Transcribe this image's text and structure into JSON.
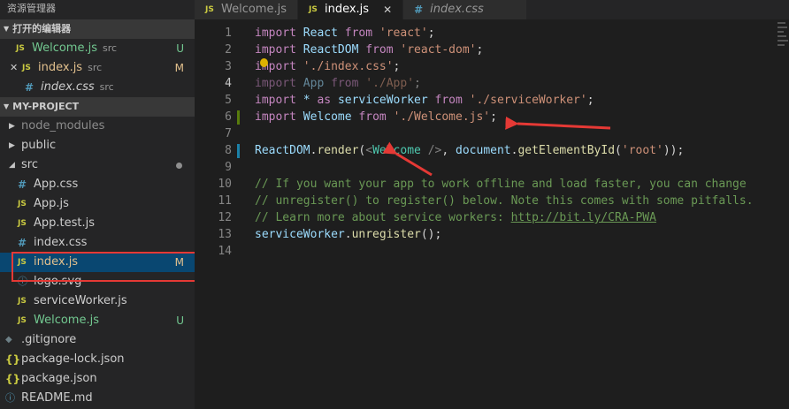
{
  "sidebar": {
    "title": "资源管理器",
    "open_editors": {
      "header": "打开的编辑器",
      "items": [
        {
          "name": "Welcome.js",
          "hint": "src",
          "status": "U"
        },
        {
          "name": "index.js",
          "hint": "src",
          "status": "M",
          "close": "✕"
        },
        {
          "name": "index.css",
          "hint": "src",
          "status": ""
        }
      ]
    },
    "project": {
      "header": "MY-PROJECT",
      "items": [
        {
          "name": "node_modules"
        },
        {
          "name": "public"
        },
        {
          "name": "src"
        },
        {
          "name": "App.css"
        },
        {
          "name": "App.js"
        },
        {
          "name": "App.test.js"
        },
        {
          "name": "index.css"
        },
        {
          "name": "index.js",
          "status": "M"
        },
        {
          "name": "logo.svg"
        },
        {
          "name": "serviceWorker.js"
        },
        {
          "name": "Welcome.js",
          "status": "U"
        },
        {
          "name": ".gitignore"
        },
        {
          "name": "package-lock.json"
        },
        {
          "name": "package.json"
        },
        {
          "name": "README.md"
        }
      ]
    }
  },
  "tabs": [
    {
      "label": "Welcome.js",
      "icon": "JS"
    },
    {
      "label": "index.js",
      "icon": "JS",
      "close": "✕"
    },
    {
      "label": "index.css",
      "icon": "#"
    }
  ],
  "icons": {
    "js": "JS",
    "css": "#",
    "json": "{}",
    "git": "◆",
    "info": "ⓘ"
  },
  "editor": {
    "lines": [
      {
        "n": "1"
      },
      {
        "n": "2"
      },
      {
        "n": "3"
      },
      {
        "n": "4"
      },
      {
        "n": "5"
      },
      {
        "n": "6"
      },
      {
        "n": "7"
      },
      {
        "n": "8"
      },
      {
        "n": "9"
      },
      {
        "n": "10"
      },
      {
        "n": "11"
      },
      {
        "n": "12"
      },
      {
        "n": "13"
      },
      {
        "n": "14"
      }
    ],
    "tokens": {
      "import": "import",
      "from": "from",
      "as": "as",
      "star": "*",
      "React": "React",
      "ReactDOM": "ReactDOM",
      "App": "App",
      "serviceWorker": "serviceWorker",
      "Welcome": "Welcome",
      "s_react": "'react'",
      "s_reactdom": "'react-dom'",
      "s_indexcss": "'./index.css'",
      "s_app": "'./App'",
      "s_sw": "'./serviceWorker'",
      "s_welcome": "'./Welcome.js'",
      "s_root": "'root'",
      "semi": ";",
      "render": "render",
      "document": "document",
      "getById": "getElementById",
      "unregister": "unregister",
      "c10": "// If you want your app to work offline and load faster, you can change",
      "c11": "// unregister() to register() below. Note this comes with some pitfalls.",
      "c12": "// Learn more about service workers: ",
      "c12_link": "http://bit.ly/CRA-PWA"
    }
  },
  "colors": {
    "highlight_red": "#e53935",
    "selected": "#094771",
    "untracked": "#73c991",
    "modified": "#e2c08d"
  }
}
